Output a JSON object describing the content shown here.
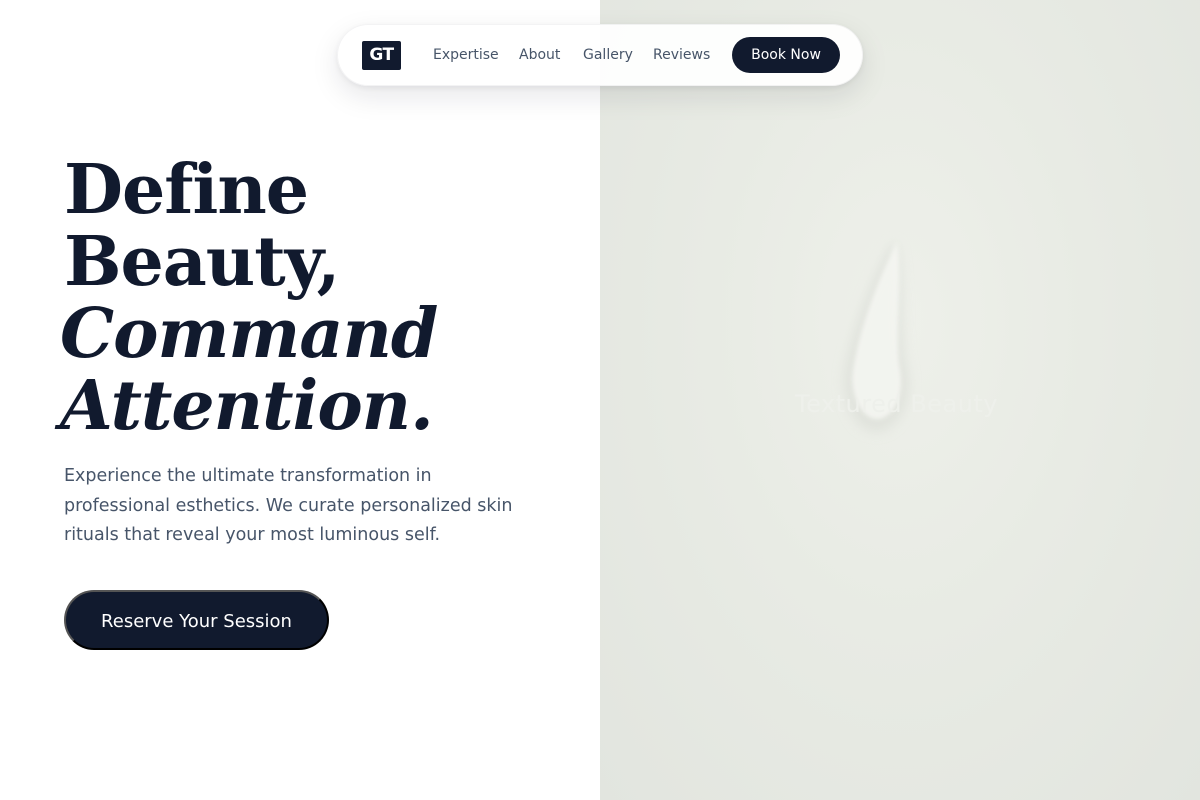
{
  "nav": {
    "logo": "GT",
    "links": [
      "Expertise",
      "About",
      "Gallery",
      "Reviews"
    ],
    "cta": "Book Now"
  },
  "hero": {
    "headline": [
      "Define",
      "Beauty,",
      "Command",
      "Attention."
    ],
    "description": "Experience the ultimate transformation in professional esthetics. We curate personalized skin rituals that reveal your most luminous self.",
    "cta": "Reserve Your Session",
    "image_caption": "Textured Beauty"
  },
  "colors": {
    "navy": "#111a2e",
    "muted_text": "#475569",
    "image_background": "#e8ebe4",
    "white": "#ffffff"
  }
}
